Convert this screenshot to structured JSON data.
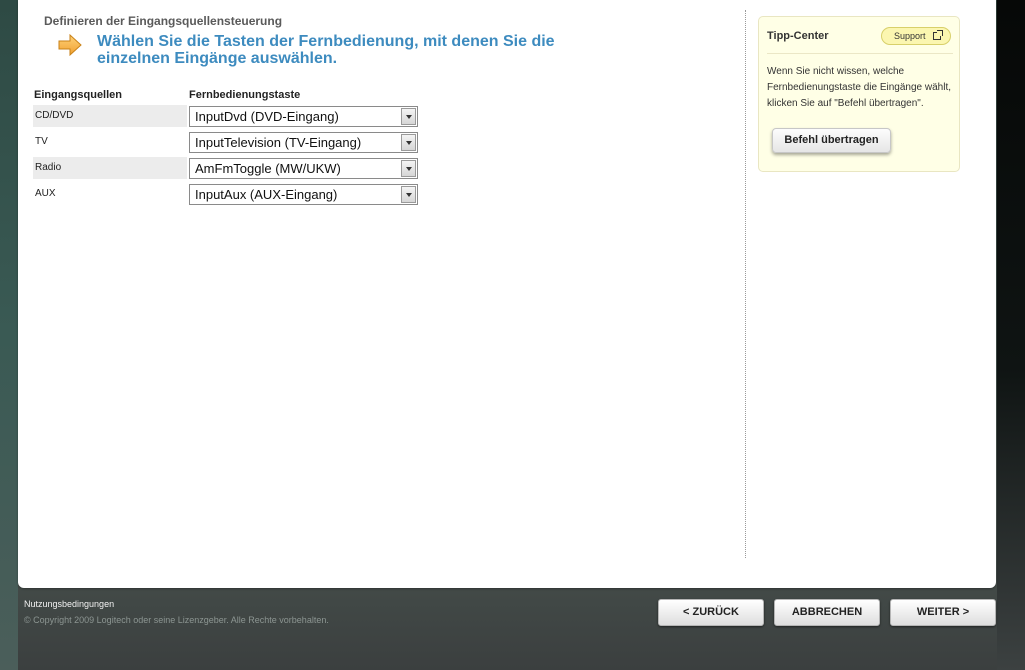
{
  "header": {
    "section_title": "Definieren der Eingangsquellensteuerung",
    "instruction": "Wählen Sie die Tasten der Fernbedienung, mit denen Sie die einzelnen Eingänge auswählen."
  },
  "table": {
    "col_source": "Eingangsquellen",
    "col_button": "Fernbedienungstaste",
    "rows": [
      {
        "source": "CD/DVD",
        "button": "InputDvd (DVD-Eingang)"
      },
      {
        "source": "TV",
        "button": "InputTelevision (TV-Eingang)"
      },
      {
        "source": "Radio",
        "button": "AmFmToggle (MW/UKW)"
      },
      {
        "source": "AUX",
        "button": "InputAux (AUX-Eingang)"
      }
    ]
  },
  "tip_center": {
    "title": "Tipp-Center",
    "support_label": "Support",
    "text": "Wenn Sie nicht wissen, welche Fernbedienungstaste die Eingänge wählt, klicken Sie auf \"Befehl übertragen\".",
    "action_label": "Befehl übertragen"
  },
  "footer": {
    "terms_link": "Nutzungsbedingungen",
    "copyright": "© Copyright 2009 Logitech oder seine Lizenzgeber. Alle Rechte vorbehalten.",
    "back_label": "< ZURÜCK",
    "cancel_label": "ABBRECHEN",
    "next_label": "WEITER >"
  },
  "colors": {
    "instruction_blue": "#3d8bbf",
    "arrow_orange": "#f0a030",
    "tip_background": "#ffffe6"
  },
  "icons": {
    "instruction": "arrow-right-icon",
    "support": "external-link-icon",
    "dropdown": "chevron-down-icon"
  }
}
